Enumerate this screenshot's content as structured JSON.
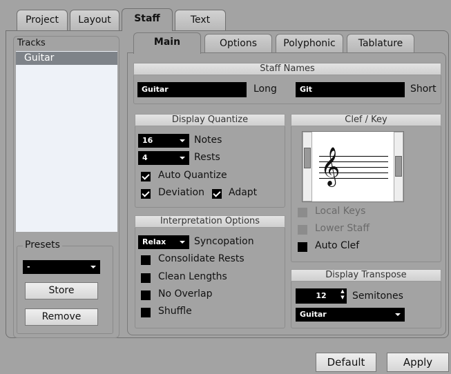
{
  "top_tabs": [
    "Project",
    "Layout",
    "Staff",
    "Text"
  ],
  "active_top_tab": "Staff",
  "tracks": {
    "label": "Tracks",
    "items": [
      "Guitar"
    ]
  },
  "presets": {
    "label": "Presets",
    "selected": "-",
    "store_label": "Store",
    "remove_label": "Remove"
  },
  "sub_tabs": [
    "Main",
    "Options",
    "Polyphonic",
    "Tablature"
  ],
  "active_sub_tab": "Main",
  "staff_names": {
    "title": "Staff Names",
    "long_value": "Guitar",
    "long_label": "Long",
    "short_value": "Git",
    "short_label": "Short"
  },
  "display_quantize": {
    "title": "Display Quantize",
    "notes_value": "16",
    "notes_label": "Notes",
    "rests_value": "4",
    "rests_label": "Rests",
    "auto_quantize": {
      "label": "Auto Quantize",
      "checked": true
    },
    "deviation": {
      "label": "Deviation",
      "checked": true
    },
    "adapt": {
      "label": "Adapt",
      "checked": true
    }
  },
  "clef_key": {
    "title": "Clef / Key",
    "local_keys": {
      "label": "Local Keys",
      "checked": false,
      "enabled": false
    },
    "lower_staff": {
      "label": "Lower Staff",
      "checked": false,
      "enabled": false
    },
    "auto_clef": {
      "label": "Auto Clef",
      "checked": false,
      "enabled": true
    },
    "clef_symbol": "𝄞"
  },
  "interpretation": {
    "title": "Interpretation Options",
    "syncopation_value": "Relax",
    "syncopation_label": "Syncopation",
    "consolidate_rests": {
      "label": "Consolidate Rests",
      "checked": false
    },
    "clean_lengths": {
      "label": "Clean Lengths",
      "checked": false
    },
    "no_overlap": {
      "label": "No Overlap",
      "checked": false
    },
    "shuffle": {
      "label": "Shuffle",
      "checked": false
    }
  },
  "display_transpose": {
    "title": "Display Transpose",
    "semitones_value": "12",
    "semitones_label": "Semitones",
    "instrument": "Guitar"
  },
  "footer": {
    "default_label": "Default",
    "apply_label": "Apply"
  }
}
